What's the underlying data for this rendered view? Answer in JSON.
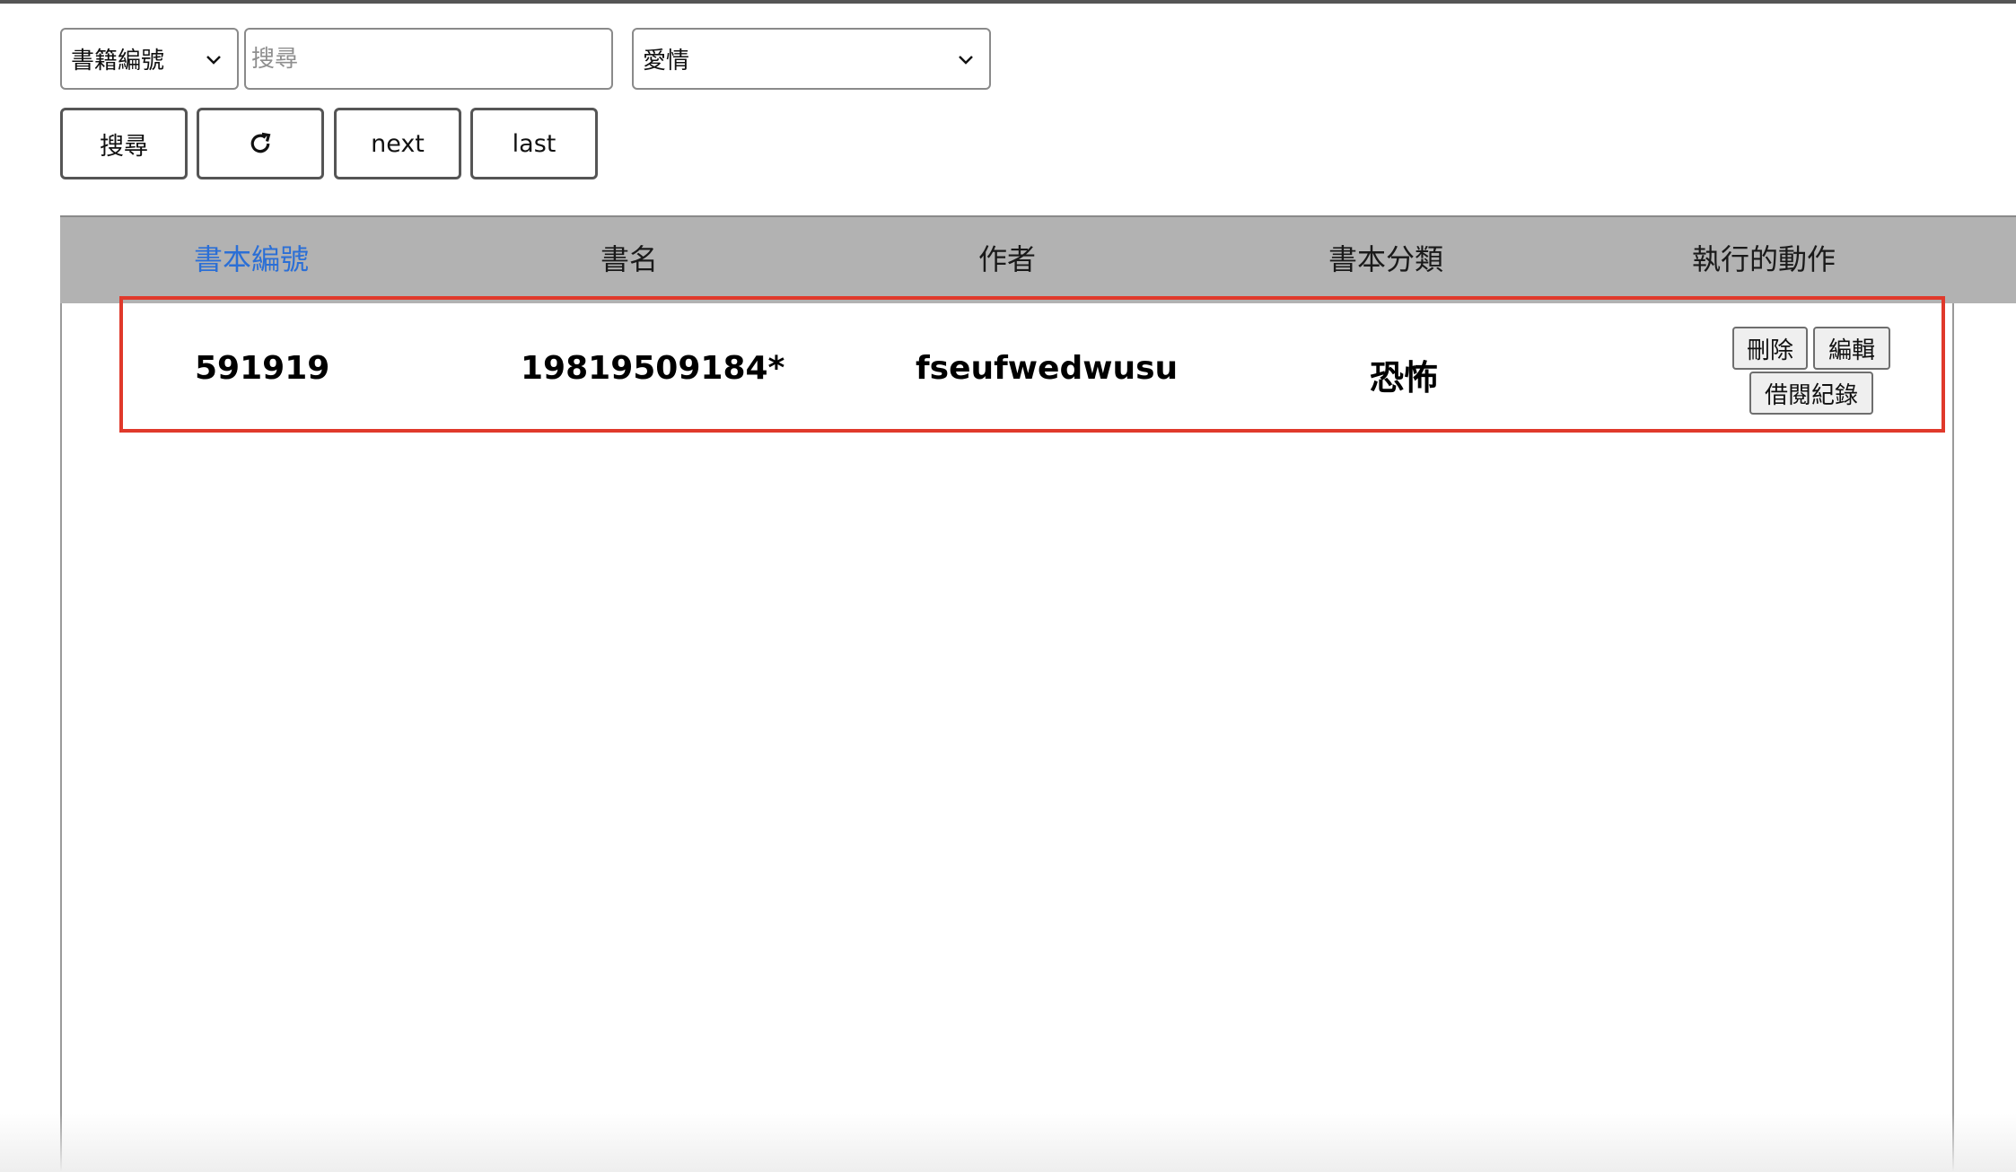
{
  "filters": {
    "field_select": "書籍編號",
    "search_placeholder": "搜尋",
    "search_value": "",
    "category_select": "愛情"
  },
  "toolbar": {
    "search_label": "搜尋",
    "refresh_icon": "refresh-icon",
    "next_label": "next",
    "last_label": "last"
  },
  "table": {
    "headers": [
      "書本編號",
      "書名",
      "作者",
      "書本分類",
      "執行的動作"
    ],
    "sorted_header_color": "#2b6fd6",
    "rows": [
      {
        "id": "591919",
        "title": "19819509184*",
        "author": "fseufwedwusu",
        "category": "恐怖",
        "actions": {
          "delete": "刪除",
          "edit": "編輯",
          "history": "借閱紀錄"
        }
      }
    ]
  },
  "highlight_color": "#e0392b"
}
